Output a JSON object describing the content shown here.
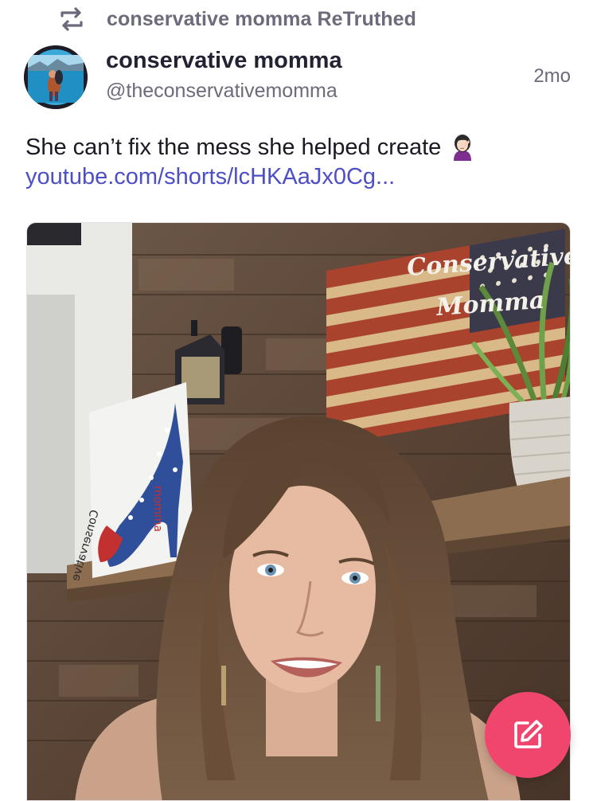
{
  "retruth": {
    "label": "conservative momma ReTruthed",
    "icon": "retruth-icon"
  },
  "post": {
    "author": {
      "display_name": "conservative momma",
      "handle": "@theconservativemomma",
      "avatar_icon": "avatar"
    },
    "time_ago": "2mo",
    "text": "She can’t fix the mess she helped create",
    "emoji": "woman-facepalming-emoji",
    "link_text": "youtube.com/shorts/lcHKAaJx0Cg...",
    "media": {
      "watermark_line1": "Conservative",
      "watermark_line2": "Momma",
      "canvas_text": "Conservative",
      "canvas_subtext": "momma"
    }
  },
  "fab": {
    "icon": "compose-icon"
  },
  "colors": {
    "accent": "#f0466e",
    "link": "#4c4fc5",
    "muted": "#6b6b7b",
    "name": "#222233"
  }
}
